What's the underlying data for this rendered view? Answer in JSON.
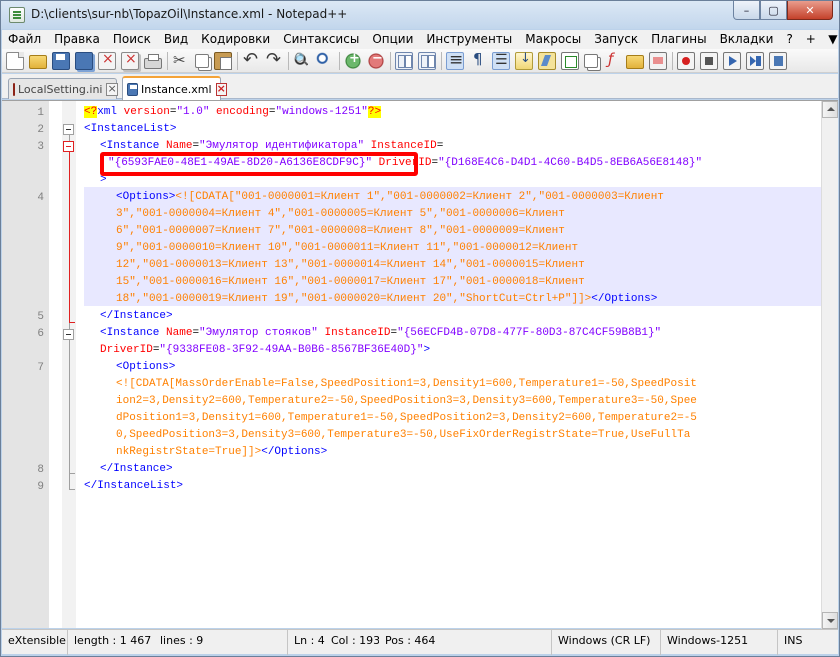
{
  "window": {
    "title": "D:\\clients\\sur-nb\\TopazOil\\Instance.xml - Notepad++",
    "controls": {
      "minimize": "–",
      "maximize": "▢",
      "close": "✕"
    }
  },
  "menu": {
    "items": [
      "Файл",
      "Правка",
      "Поиск",
      "Вид",
      "Кодировки",
      "Синтаксисы",
      "Опции",
      "Инструменты",
      "Макросы",
      "Запуск",
      "Плагины",
      "Вкладки",
      "?"
    ],
    "right": [
      "+",
      "▼",
      "X"
    ]
  },
  "tabs": [
    {
      "label": "LocalSetting.ini",
      "active": false
    },
    {
      "label": "Instance.xml",
      "active": true
    }
  ],
  "editor": {
    "line_numbers": [
      "1",
      "2",
      "3",
      "4",
      "5",
      "6",
      "7",
      "8",
      "9"
    ],
    "lines": {
      "l1": {
        "pi_open": "<?",
        "tag": "xml",
        "a1": " version",
        "eq1": "=",
        "v1": "\"1.0\"",
        "a2": " encoding",
        "eq2": "=",
        "v2": "\"windows-1251\"",
        "pi_close": "?>"
      },
      "l2": {
        "tag": "<InstanceList>"
      },
      "l3a": {
        "tag": "<Instance",
        "a1": " Name",
        "eq1": "=",
        "v1": "\"Эмулятор идентификатора\"",
        "a2": " InstanceID",
        "eq2": "="
      },
      "l3b": {
        "v2": "\"{6593FAE0-48E1-49AE-8D20-A6136E8CDF9C}\"",
        "a3": " DriverID",
        "eq3": "=",
        "v3": "\"{D168E4C6-D4D1-4C60-B4D5-8EB6A56E8148}\""
      },
      "l3c": {
        "tag": ">"
      },
      "l4": {
        "open": "<Options>",
        "wrap": [
          "<![CDATA[\"001-0000001=Клиент 1\",\"001-0000002=Клиент 2\",\"001-0000003=Клиент",
          "3\",\"001-0000004=Клиент 4\",\"001-0000005=Клиент 5\",\"001-0000006=Клиент",
          "6\",\"001-0000007=Клиент 7\",\"001-0000008=Клиент 8\",\"001-0000009=Клиент",
          "9\",\"001-0000010=Клиент 10\",\"001-0000011=Клиент 11\",\"001-0000012=Клиент",
          "12\",\"001-0000013=Клиент 13\",\"001-0000014=Клиент 14\",\"001-0000015=Клиент",
          "15\",\"001-0000016=Клиент 16\",\"001-0000017=Клиент 17\",\"001-0000018=Клиент",
          "18\",\"001-0000019=Клиент 19\",\"001-0000020=Клиент 20\",\"ShortCut=Ctrl+P\"]]>"
        ],
        "close": "</Options>"
      },
      "l5": {
        "tag": "</Instance>"
      },
      "l6a": {
        "tag": "<Instance",
        "a1": " Name",
        "eq1": "=",
        "v1": "\"Эмулятор стояков\"",
        "a2": " InstanceID",
        "eq2": "=",
        "v2": "\"{56ECFD4B-07D8-477F-80D3-87C4CF59B8B1}\""
      },
      "l6b": {
        "a3": "DriverID",
        "eq3": "=",
        "v3": "\"{9338FE08-3F92-49AA-B0B6-8567BF36E40D}\"",
        "close": ">"
      },
      "l7a": {
        "tag": "<Options>"
      },
      "l7": {
        "wrap": [
          "<![CDATA[MassOrderEnable=False,SpeedPosition1=3,Density1=600,Temperature1=-50,SpeedPosit",
          "ion2=3,Density2=600,Temperature2=-50,SpeedPosition3=3,Density3=600,Temperature3=-50,Spee",
          "dPosition1=3,Density1=600,Temperature1=-50,SpeedPosition2=3,Density2=600,Temperature2=-5",
          "0,SpeedPosition3=3,Density3=600,Temperature3=-50,UseFixOrderRegistrState=True,UseFullTa",
          "nkRegistrState=True]]>"
        ],
        "close": "</Options>"
      },
      "l8": {
        "tag": "</Instance>"
      },
      "l9": {
        "tag": "</InstanceList>"
      }
    }
  },
  "statusbar": {
    "lang": "eXtensible I",
    "length": "length : 1 467",
    "lines": "lines : 9",
    "ln": "Ln : 4",
    "col": "Col : 193",
    "pos": "Pos : 464",
    "eol": "Windows (CR LF)",
    "encoding": "Windows-1251",
    "mode": "INS"
  }
}
